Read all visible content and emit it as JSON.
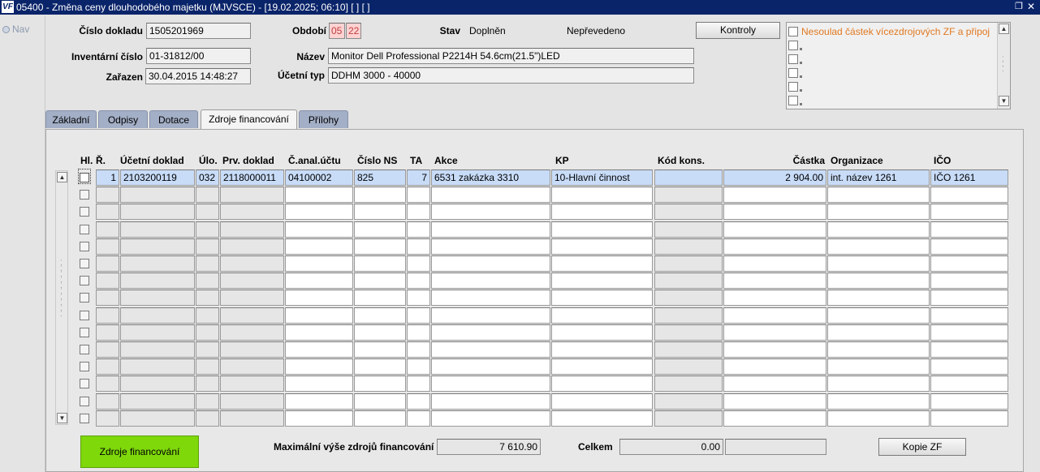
{
  "window": {
    "title": "05400 - Změna ceny dlouhodobého majetku (MJVSCE) - [19.02.2025; 06:10]  [ ]  [ ]",
    "icon_label": "VF"
  },
  "nav": {
    "label": "Nav"
  },
  "header": {
    "cislo_dokladu_label": "Číslo dokladu",
    "cislo_dokladu_value": "1505201969",
    "obdobi_label": "Období",
    "obdobi_month": "05",
    "obdobi_year": "22",
    "stav_label": "Stav",
    "stav_value": "Doplněn",
    "stav_value2": "Nepřevedeno",
    "kontroly_button": "Kontroly",
    "inventarni_cislo_label": "Inventární číslo",
    "inventarni_cislo_value": "01-31812/00",
    "nazev_label": "Název",
    "nazev_value": "Monitor Dell Professional P2214H 54.6cm(21.5\")LED",
    "zarazen_label": "Zařazen",
    "zarazen_value": "30.04.2015 14:48:27",
    "ucetni_typ_label": "Účetní typ",
    "ucetni_typ_value": "DDHM 3000 - 40000"
  },
  "warnings": {
    "items": [
      "Nesoulad částek vícezdrojových ZF a připoj",
      "",
      "",
      "",
      "",
      ""
    ]
  },
  "tabs": [
    {
      "label": "Základní"
    },
    {
      "label": "Odpisy"
    },
    {
      "label": "Dotace"
    },
    {
      "label": "Zdroje financování"
    },
    {
      "label": "Přílohy"
    }
  ],
  "table": {
    "columns": [
      "Hl.",
      "Ř.",
      "Účetní doklad",
      "Úlo.",
      "Prv. doklad",
      "Č.anal.účtu",
      "Číslo NS",
      "TA",
      "Akce",
      "KP",
      "Kód kons.",
      "Částka",
      "Organizace",
      "IČO"
    ],
    "rows": [
      [
        "",
        "1",
        "2103200119",
        "032",
        "2118000011",
        "04100002",
        "825",
        "7",
        "6531 zakázka 3310",
        "10-Hlavní činnost",
        "",
        "2 904.00",
        "int. název 1261",
        "IČO 1261"
      ]
    ]
  },
  "footer": {
    "zdroje_button": "Zdroje financování",
    "max_label": "Maximální výše zdrojů financování",
    "max_value": "7 610.90",
    "celkem_label": "Celkem",
    "celkem_value": "0.00",
    "celkem_extra": "",
    "kopie_button": "Kopie ZF"
  },
  "colors": {
    "titlebar": "#0a246a",
    "tab_inactive": "#a3afc6",
    "warning_text": "#e07820",
    "selected_row": "#c8dcf8",
    "green_button": "#7ed80a",
    "period_field": "#ffd2d2"
  }
}
